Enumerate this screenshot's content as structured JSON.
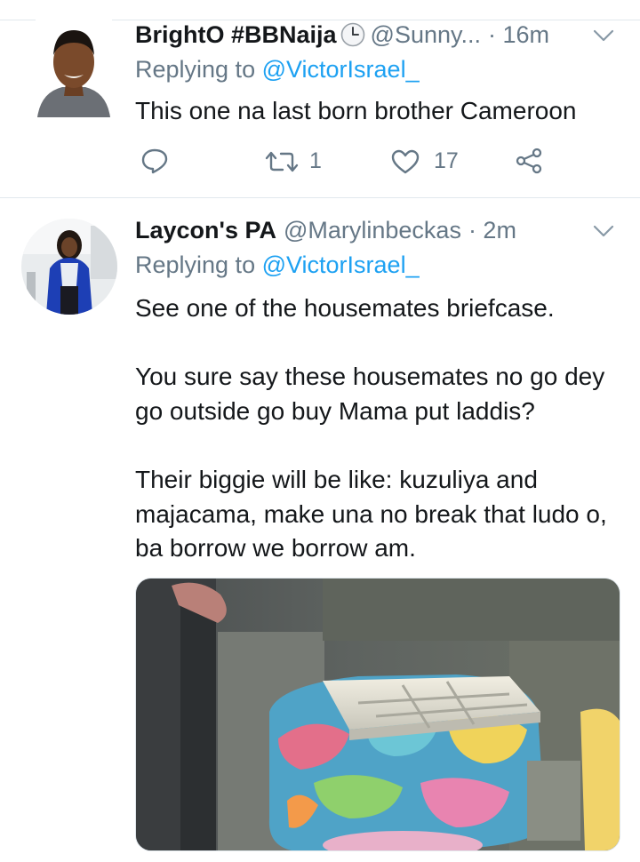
{
  "tweets": [
    {
      "display_name": "BrightO #BBNaija",
      "handle": "@Sunny...",
      "time": "· 16m",
      "replying_prefix": "Replying to",
      "replying_to": "@VictorIsrael_",
      "text": "This one na last born brother Cameroon",
      "retweets": "1",
      "likes": "17"
    },
    {
      "display_name": "Laycon's PA",
      "handle": "@Marylinbeckas",
      "time": "· 2m",
      "replying_prefix": "Replying to",
      "replying_to": "@VictorIsrael_",
      "paragraphs": [
        "See one of the housemates briefcase.",
        "You sure say these housemates no go dey go outside go buy Mama put laddis?",
        "Their biggie will be like: kuzuliya and majacama, make una no break that ludo o, ba borrow we borrow am."
      ]
    }
  ],
  "icons": {
    "clock": "clock-emoji-icon",
    "chevron": "chevron-down-icon",
    "reply": "reply-icon",
    "retweet": "retweet-icon",
    "like": "heart-icon",
    "share": "share-icon"
  },
  "colors": {
    "accent": "#1da1f2",
    "secondary_text": "#657786",
    "divider": "#e1e8ed"
  }
}
